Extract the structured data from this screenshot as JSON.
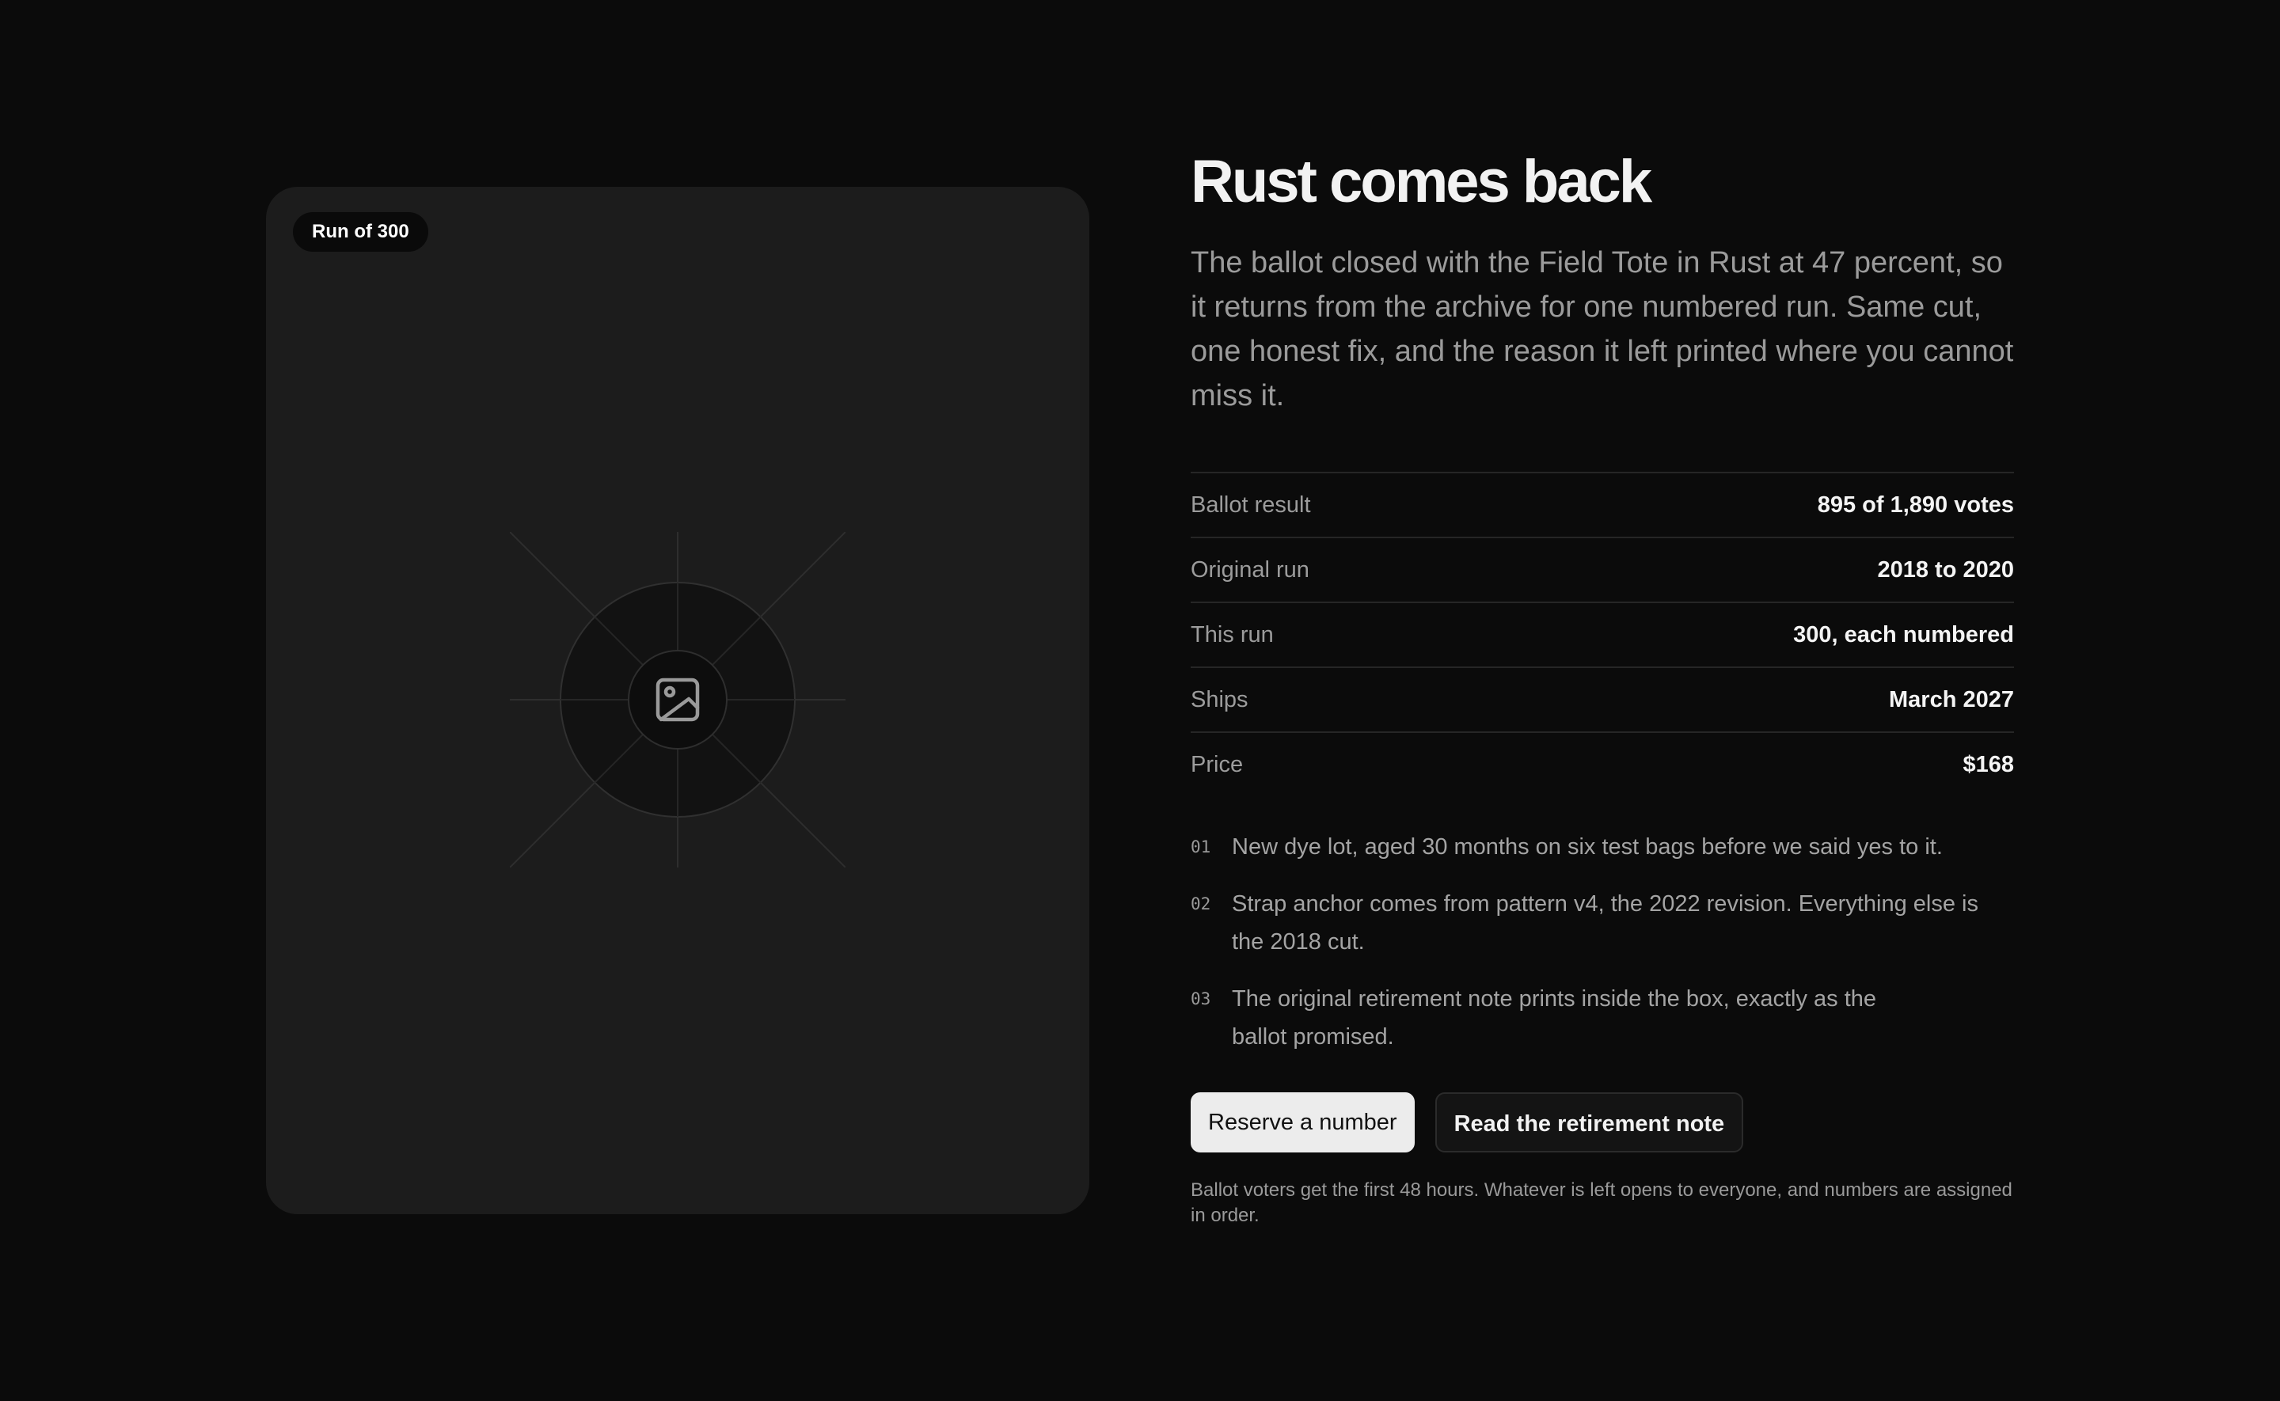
{
  "media": {
    "badge": "Run of 300",
    "icon": "image-icon"
  },
  "product": {
    "title": "Rust comes back",
    "description": "The ballot closed with the Field Tote in Rust at 47 percent, so it returns from the archive for one numbered run. Same cut, one honest fix, and the reason it left printed where you cannot miss it."
  },
  "specs": [
    {
      "label": "Ballot result",
      "value": "895 of 1,890 votes"
    },
    {
      "label": "Original run",
      "value": "2018 to 2020"
    },
    {
      "label": "This run",
      "value": "300, each numbered"
    },
    {
      "label": "Ships",
      "value": "March 2027"
    },
    {
      "label": "Price",
      "value": "$168"
    }
  ],
  "notes": [
    {
      "num": "01",
      "text": "New dye lot, aged 30 months on six test bags before we said yes to it."
    },
    {
      "num": "02",
      "text": "Strap anchor comes from pattern v4, the 2022 revision. Everything else is the 2018 cut."
    },
    {
      "num": "03",
      "text": "The original retirement note prints inside the box, exactly as the ballot promised."
    }
  ],
  "actions": {
    "primary": "Reserve a number",
    "secondary": "Read the retirement note"
  },
  "fine_print": "Ballot voters get the first 48 hours. Whatever is left opens to everyone, and numbers are assigned in order.",
  "colors": {
    "background": "#0b0b0b",
    "card": "#1c1c1c",
    "primary_button": "#ececec"
  }
}
